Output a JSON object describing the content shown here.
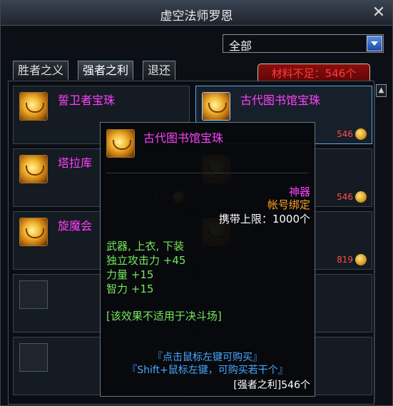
{
  "window": {
    "title": "虚空法师罗恩"
  },
  "filter": {
    "selected": "全部"
  },
  "tabs": [
    {
      "label": "胜者之义"
    },
    {
      "label": "强者之利"
    },
    {
      "label": "退还"
    }
  ],
  "warning": "材料不足：546个",
  "items": [
    {
      "name": "誓卫者宝珠",
      "price": ""
    },
    {
      "name": "古代图书馆宝珠",
      "price": "546"
    },
    {
      "name": "塔拉库",
      "price": "546"
    },
    {
      "name": "",
      "price": "546"
    },
    {
      "name": "旋魔会",
      "price": ""
    },
    {
      "name": "",
      "price": "819"
    }
  ],
  "tooltip": {
    "name": "古代图书馆宝珠",
    "rarity": "神器",
    "binding": "帐号绑定",
    "carry_limit": "携带上限：1000个",
    "slots": "武器, 上衣, 下装",
    "stats": [
      "独立攻击力 +45",
      "力量 +15",
      "智力 +15"
    ],
    "note": "[该效果不适用于决斗场]",
    "hint1": "『点击鼠标左键可购买』",
    "hint2": "『Shift+鼠标左键，可购买若干个』",
    "cost": "[强者之利]546个"
  },
  "colors": {
    "name": "#ff40ff",
    "rarity": "#ff40ff",
    "binding": "#ffa020",
    "stats": "#76e85c",
    "hint": "#4aa8ff",
    "warning": "#ff3b3b"
  }
}
